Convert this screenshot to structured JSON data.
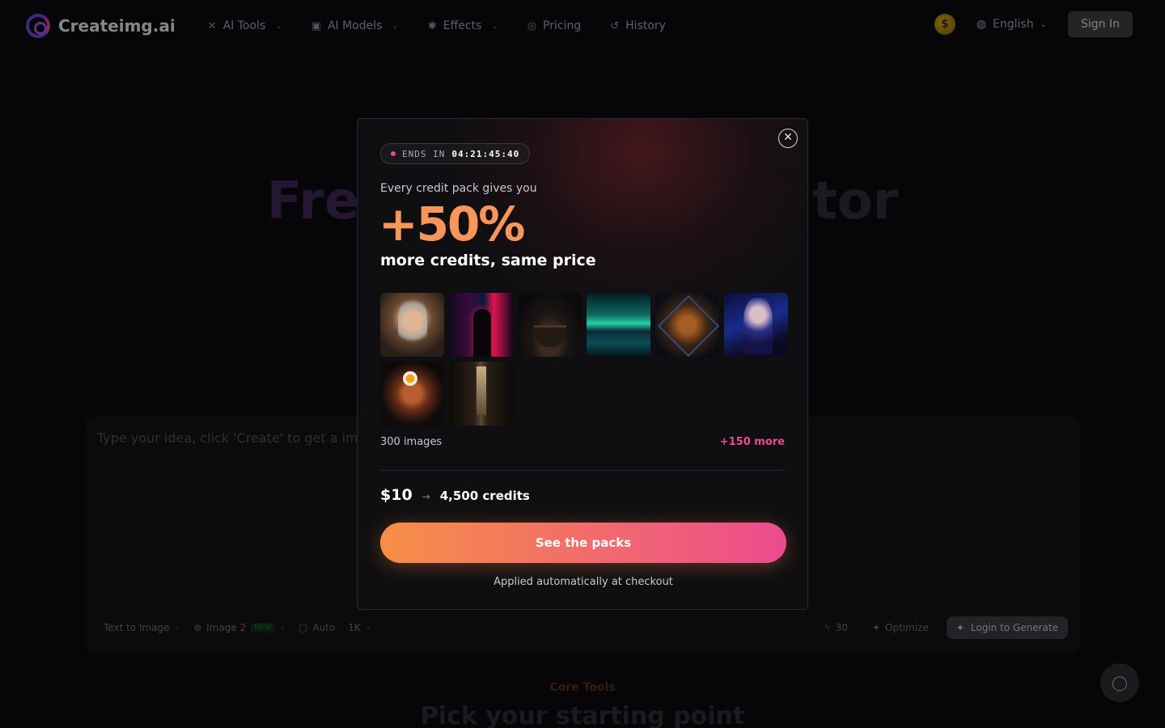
{
  "header": {
    "brand": "Createimg.ai",
    "nav": [
      {
        "label": "AI Tools",
        "icon": "tools-icon",
        "dropdown": true
      },
      {
        "label": "AI Models",
        "icon": "robot-icon",
        "dropdown": true
      },
      {
        "label": "Effects",
        "icon": "sparkle-icon",
        "dropdown": true
      },
      {
        "label": "Pricing",
        "icon": "tag-icon",
        "dropdown": false
      },
      {
        "label": "History",
        "icon": "history-icon",
        "dropdown": false
      }
    ],
    "coin_symbol": "$",
    "language": "English",
    "sign_in": "Sign In"
  },
  "hero": {
    "title_start": "Fre",
    "title_end": "tor"
  },
  "prompt": {
    "placeholder": "Type your idea, click 'Create' to get a image",
    "mode": "Text to Image",
    "model": "Image 2",
    "model_badge": "NEW",
    "ratio": "Auto",
    "resolution": "1K",
    "cost": "30",
    "optimize": "Optimize",
    "login_button": "Login to Generate"
  },
  "section": {
    "label": "Core Tools",
    "title": "Pick your starting point"
  },
  "modal": {
    "timer_label": "ENDS IN",
    "timer_value": "04:21:45:40",
    "pre_text": "Every credit pack gives you",
    "big_text": "+50%",
    "sub_text": "more credits, same price",
    "images_count": "300 images",
    "more_text": "+150 more",
    "price": "$10",
    "arrow": "→",
    "credits": "4,500 credits",
    "cta": "See the packs",
    "footnote": "Applied automatically at checkout"
  },
  "colors": {
    "accent_orange": "#f78f45",
    "accent_pink": "#ec4b8f",
    "background": "#0b0b0d"
  }
}
